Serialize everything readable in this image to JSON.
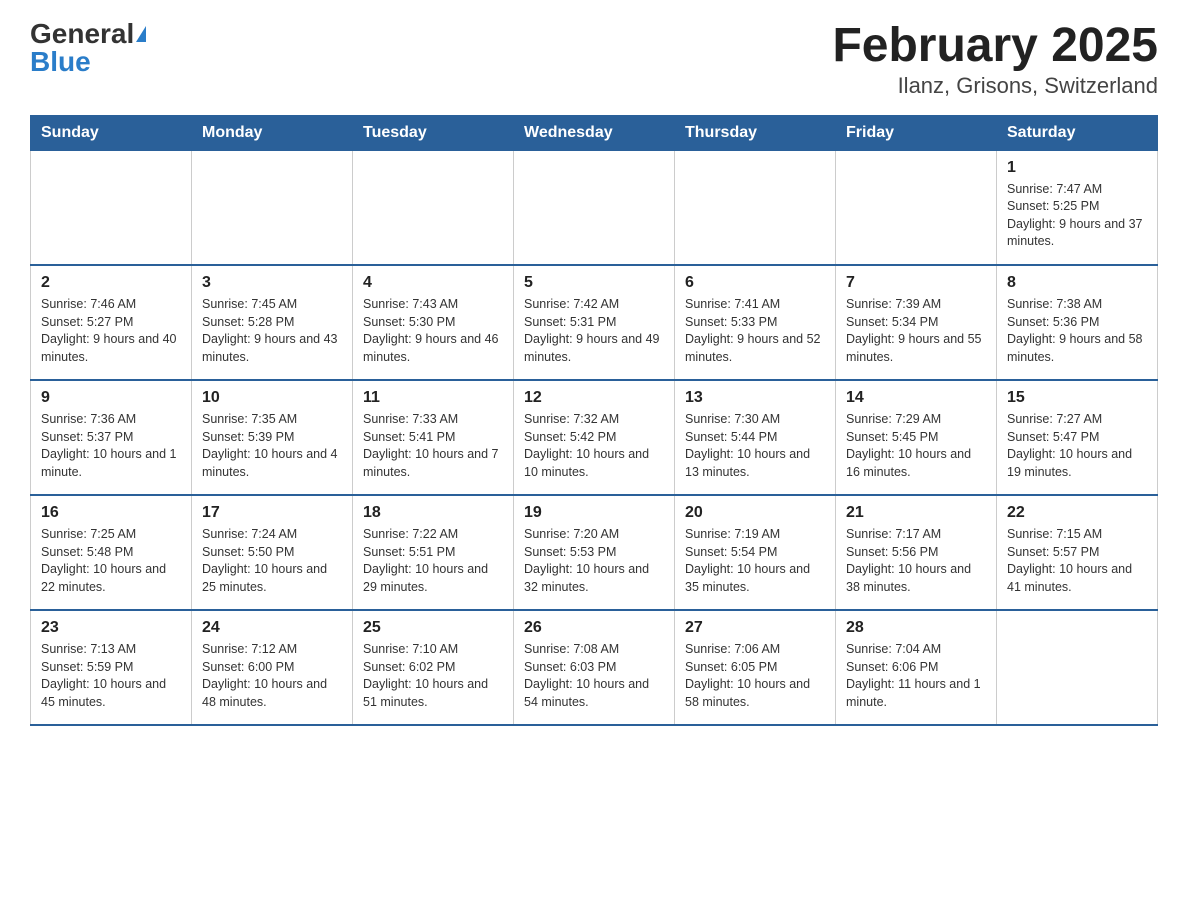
{
  "header": {
    "logo_general": "General",
    "logo_blue": "Blue",
    "title": "February 2025",
    "subtitle": "Ilanz, Grisons, Switzerland"
  },
  "weekdays": [
    "Sunday",
    "Monday",
    "Tuesday",
    "Wednesday",
    "Thursday",
    "Friday",
    "Saturday"
  ],
  "weeks": [
    [
      {
        "day": "",
        "sunrise": "",
        "sunset": "",
        "daylight": ""
      },
      {
        "day": "",
        "sunrise": "",
        "sunset": "",
        "daylight": ""
      },
      {
        "day": "",
        "sunrise": "",
        "sunset": "",
        "daylight": ""
      },
      {
        "day": "",
        "sunrise": "",
        "sunset": "",
        "daylight": ""
      },
      {
        "day": "",
        "sunrise": "",
        "sunset": "",
        "daylight": ""
      },
      {
        "day": "",
        "sunrise": "",
        "sunset": "",
        "daylight": ""
      },
      {
        "day": "1",
        "sunrise": "Sunrise: 7:47 AM",
        "sunset": "Sunset: 5:25 PM",
        "daylight": "Daylight: 9 hours and 37 minutes."
      }
    ],
    [
      {
        "day": "2",
        "sunrise": "Sunrise: 7:46 AM",
        "sunset": "Sunset: 5:27 PM",
        "daylight": "Daylight: 9 hours and 40 minutes."
      },
      {
        "day": "3",
        "sunrise": "Sunrise: 7:45 AM",
        "sunset": "Sunset: 5:28 PM",
        "daylight": "Daylight: 9 hours and 43 minutes."
      },
      {
        "day": "4",
        "sunrise": "Sunrise: 7:43 AM",
        "sunset": "Sunset: 5:30 PM",
        "daylight": "Daylight: 9 hours and 46 minutes."
      },
      {
        "day": "5",
        "sunrise": "Sunrise: 7:42 AM",
        "sunset": "Sunset: 5:31 PM",
        "daylight": "Daylight: 9 hours and 49 minutes."
      },
      {
        "day": "6",
        "sunrise": "Sunrise: 7:41 AM",
        "sunset": "Sunset: 5:33 PM",
        "daylight": "Daylight: 9 hours and 52 minutes."
      },
      {
        "day": "7",
        "sunrise": "Sunrise: 7:39 AM",
        "sunset": "Sunset: 5:34 PM",
        "daylight": "Daylight: 9 hours and 55 minutes."
      },
      {
        "day": "8",
        "sunrise": "Sunrise: 7:38 AM",
        "sunset": "Sunset: 5:36 PM",
        "daylight": "Daylight: 9 hours and 58 minutes."
      }
    ],
    [
      {
        "day": "9",
        "sunrise": "Sunrise: 7:36 AM",
        "sunset": "Sunset: 5:37 PM",
        "daylight": "Daylight: 10 hours and 1 minute."
      },
      {
        "day": "10",
        "sunrise": "Sunrise: 7:35 AM",
        "sunset": "Sunset: 5:39 PM",
        "daylight": "Daylight: 10 hours and 4 minutes."
      },
      {
        "day": "11",
        "sunrise": "Sunrise: 7:33 AM",
        "sunset": "Sunset: 5:41 PM",
        "daylight": "Daylight: 10 hours and 7 minutes."
      },
      {
        "day": "12",
        "sunrise": "Sunrise: 7:32 AM",
        "sunset": "Sunset: 5:42 PM",
        "daylight": "Daylight: 10 hours and 10 minutes."
      },
      {
        "day": "13",
        "sunrise": "Sunrise: 7:30 AM",
        "sunset": "Sunset: 5:44 PM",
        "daylight": "Daylight: 10 hours and 13 minutes."
      },
      {
        "day": "14",
        "sunrise": "Sunrise: 7:29 AM",
        "sunset": "Sunset: 5:45 PM",
        "daylight": "Daylight: 10 hours and 16 minutes."
      },
      {
        "day": "15",
        "sunrise": "Sunrise: 7:27 AM",
        "sunset": "Sunset: 5:47 PM",
        "daylight": "Daylight: 10 hours and 19 minutes."
      }
    ],
    [
      {
        "day": "16",
        "sunrise": "Sunrise: 7:25 AM",
        "sunset": "Sunset: 5:48 PM",
        "daylight": "Daylight: 10 hours and 22 minutes."
      },
      {
        "day": "17",
        "sunrise": "Sunrise: 7:24 AM",
        "sunset": "Sunset: 5:50 PM",
        "daylight": "Daylight: 10 hours and 25 minutes."
      },
      {
        "day": "18",
        "sunrise": "Sunrise: 7:22 AM",
        "sunset": "Sunset: 5:51 PM",
        "daylight": "Daylight: 10 hours and 29 minutes."
      },
      {
        "day": "19",
        "sunrise": "Sunrise: 7:20 AM",
        "sunset": "Sunset: 5:53 PM",
        "daylight": "Daylight: 10 hours and 32 minutes."
      },
      {
        "day": "20",
        "sunrise": "Sunrise: 7:19 AM",
        "sunset": "Sunset: 5:54 PM",
        "daylight": "Daylight: 10 hours and 35 minutes."
      },
      {
        "day": "21",
        "sunrise": "Sunrise: 7:17 AM",
        "sunset": "Sunset: 5:56 PM",
        "daylight": "Daylight: 10 hours and 38 minutes."
      },
      {
        "day": "22",
        "sunrise": "Sunrise: 7:15 AM",
        "sunset": "Sunset: 5:57 PM",
        "daylight": "Daylight: 10 hours and 41 minutes."
      }
    ],
    [
      {
        "day": "23",
        "sunrise": "Sunrise: 7:13 AM",
        "sunset": "Sunset: 5:59 PM",
        "daylight": "Daylight: 10 hours and 45 minutes."
      },
      {
        "day": "24",
        "sunrise": "Sunrise: 7:12 AM",
        "sunset": "Sunset: 6:00 PM",
        "daylight": "Daylight: 10 hours and 48 minutes."
      },
      {
        "day": "25",
        "sunrise": "Sunrise: 7:10 AM",
        "sunset": "Sunset: 6:02 PM",
        "daylight": "Daylight: 10 hours and 51 minutes."
      },
      {
        "day": "26",
        "sunrise": "Sunrise: 7:08 AM",
        "sunset": "Sunset: 6:03 PM",
        "daylight": "Daylight: 10 hours and 54 minutes."
      },
      {
        "day": "27",
        "sunrise": "Sunrise: 7:06 AM",
        "sunset": "Sunset: 6:05 PM",
        "daylight": "Daylight: 10 hours and 58 minutes."
      },
      {
        "day": "28",
        "sunrise": "Sunrise: 7:04 AM",
        "sunset": "Sunset: 6:06 PM",
        "daylight": "Daylight: 11 hours and 1 minute."
      },
      {
        "day": "",
        "sunrise": "",
        "sunset": "",
        "daylight": ""
      }
    ]
  ]
}
